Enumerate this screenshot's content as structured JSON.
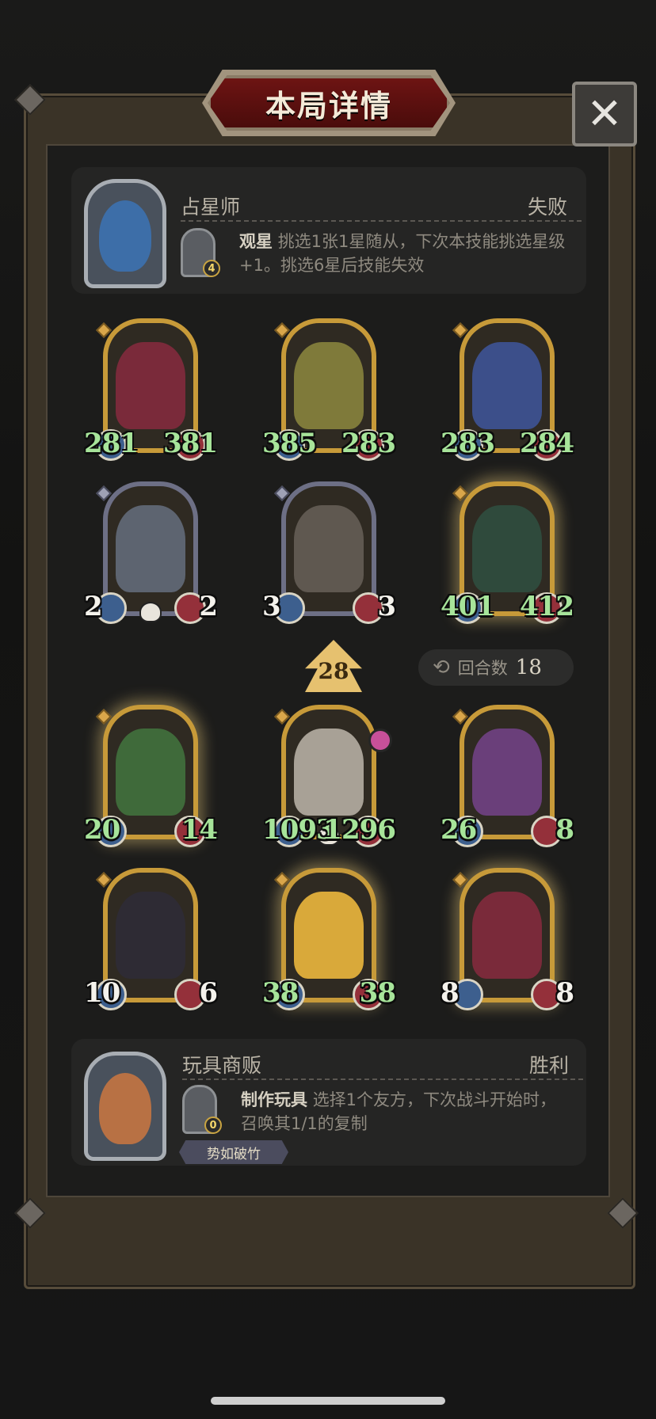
{
  "title": "本局详情",
  "close_label": "✕",
  "top_player": {
    "name": "占星师",
    "result": "失败",
    "skill_level": "4",
    "skill_name": "观星",
    "skill_desc": "挑选1张1星随从，下次本技能挑选星级+1。挑选6星后技能失效"
  },
  "opponent_board": [
    {
      "atk": "281",
      "hp": "381",
      "frame": "gold",
      "color": "green"
    },
    {
      "atk": "385",
      "hp": "283",
      "frame": "gold",
      "color": "green"
    },
    {
      "atk": "283",
      "hp": "284",
      "frame": "gold",
      "color": "green"
    },
    {
      "atk": "2",
      "hp": "2",
      "frame": "silver",
      "color": "white"
    },
    {
      "atk": "3",
      "hp": "3",
      "frame": "silver",
      "color": "white"
    },
    {
      "atk": "401",
      "hp": "412",
      "frame": "gold",
      "color": "green"
    }
  ],
  "tavern_tier": "28",
  "turns": {
    "label": "回合数",
    "value": "18"
  },
  "player_board": [
    {
      "atk": "20",
      "hp": "14",
      "frame": "gold",
      "color": "green"
    },
    {
      "atk": "1093",
      "hp": "1296",
      "frame": "gold",
      "color": "green"
    },
    {
      "atk": "26",
      "hp": "8",
      "frame": "gold",
      "color": "green"
    },
    {
      "atk": "10",
      "hp": "6",
      "frame": "gold",
      "color": "white"
    },
    {
      "atk": "38",
      "hp": "38",
      "frame": "gold",
      "color": "green"
    },
    {
      "atk": "8",
      "hp": "8",
      "frame": "gold",
      "color": "white"
    }
  ],
  "bottom_player": {
    "name": "玩具商贩",
    "result": "胜利",
    "skill_level": "0",
    "skill_name": "制作玩具",
    "skill_desc": "选择1个友方，下次战斗开始时，召唤其1/1的复制",
    "tag": "势如破竹"
  }
}
